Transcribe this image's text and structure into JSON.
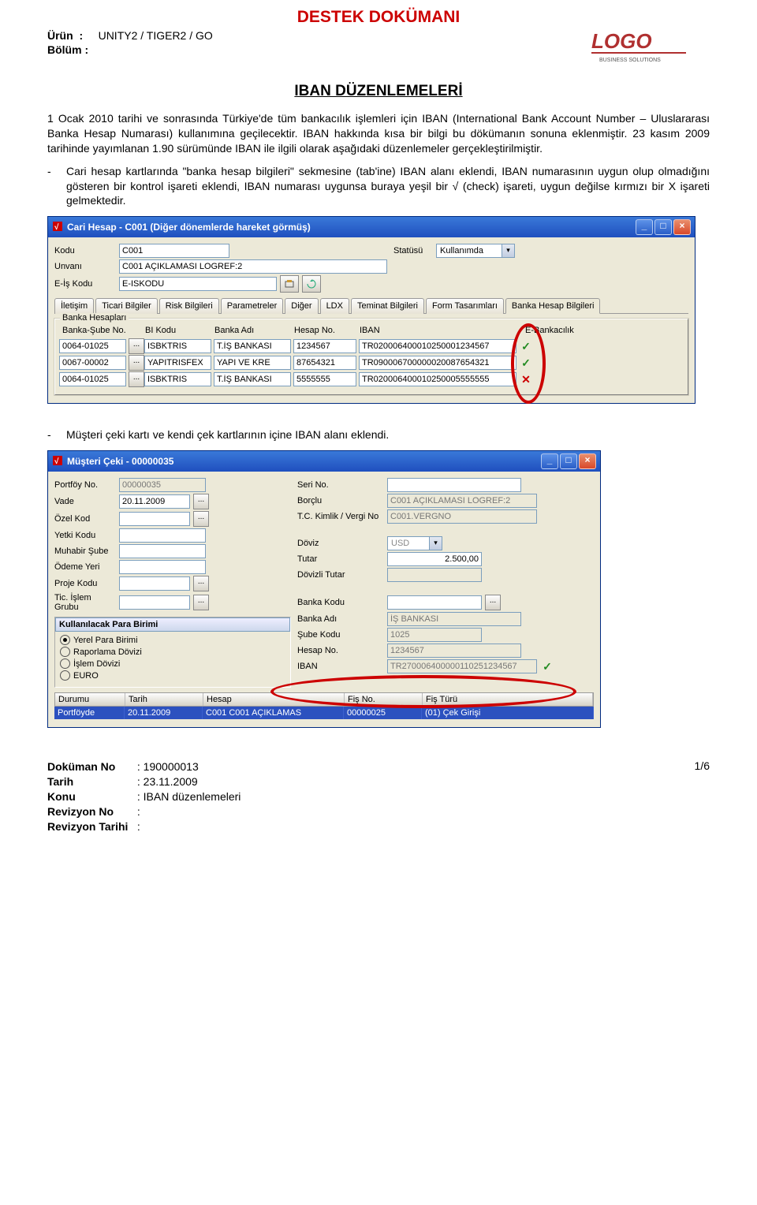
{
  "doc": {
    "title": "DESTEK DOKÜMANI",
    "urun_label": "Ürün",
    "urun_value": "UNITY2 / TIGER2 / GO",
    "bolum_label": "Bölüm",
    "logo_text": "LOGO",
    "logo_sub": "BUSINESS SOLUTIONS",
    "section_title": "IBAN DÜZENLEMELERİ",
    "para1": "1 Ocak 2010 tarihi ve sonrasında Türkiye'de tüm bankacılık işlemleri için IBAN (International Bank Account Number – Uluslararası Banka Hesap Numarası) kullanımına geçilecektir. IBAN hakkında kısa bir bilgi bu dökümanın sonuna eklenmiştir. 23 kasım 2009 tarihinde yayımlanan 1.90 sürümünde IBAN ile ilgili olarak aşağıdaki düzenlemeler gerçekleştirilmiştir.",
    "bullet1": "Cari hesap kartlarında \"banka hesap bilgileri\" sekmesine (tab'ine) IBAN alanı eklendi, IBAN numarasının uygun olup olmadığını gösteren bir kontrol işareti eklendi, IBAN numarası uygunsa buraya yeşil bir √ (check) işareti, uygun değilse kırmızı bir X işareti gelmektedir.",
    "bullet2": "Müşteri çeki kartı ve kendi çek kartlarının içine IBAN alanı eklendi.",
    "page_no": "1/6",
    "footer": {
      "dokuman_no_label": "Doküman No",
      "dokuman_no": "190000013",
      "tarih_label": "Tarih",
      "tarih": "23.11.2009",
      "konu_label": "Konu",
      "konu": "IBAN düzenlemeleri",
      "revno_label": "Revizyon No",
      "revno": "",
      "revtarih_label": "Revizyon Tarihi",
      "revtarih": ""
    }
  },
  "dlg1": {
    "title": "Cari Hesap - C001 (Diğer dönemlerde hareket görmüş)",
    "labels": {
      "kodu": "Kodu",
      "unvani": "Unvanı",
      "eis": "E-İş Kodu",
      "statusu": "Statüsü"
    },
    "kodu": "C001",
    "unvani": "C001 AÇIKLAMASI LOGREF:2",
    "eis": "E-ISKODU",
    "statusu": "Kullanımda",
    "tabs": [
      "İletişim",
      "Ticari Bilgiler",
      "Risk Bilgileri",
      "Parametreler",
      "Diğer",
      "LDX",
      "Teminat Bilgileri",
      "Form Tasarımları",
      "Banka Hesap Bilgileri"
    ],
    "banka_frame_title": "Banka Hesapları",
    "banka_headers": {
      "sube": "Banka-Şube No.",
      "bikodu": "BI Kodu",
      "bankadi": "Banka Adı",
      "hesap": "Hesap No.",
      "iban": "IBAN",
      "ebank": "E-Bankacılık"
    },
    "banka_rows": [
      {
        "sube": "0064-01025",
        "bi": "ISBKTRIS",
        "ad": "T.İŞ BANKASI",
        "hesap": "1234567",
        "iban": "TR020006400010250001234567",
        "ok": true
      },
      {
        "sube": "0067-00002",
        "bi": "YAPITRISFEX",
        "ad": "YAPI VE KRE",
        "hesap": "87654321",
        "iban": "TR090006700000020087654321",
        "ok": true
      },
      {
        "sube": "0064-01025",
        "bi": "ISBKTRIS",
        "ad": "T.İŞ BANKASI",
        "hesap": "5555555",
        "iban": "TR020006400010250005555555",
        "ok": false
      }
    ]
  },
  "dlg2": {
    "title": "Müşteri Çeki - 00000035",
    "left": {
      "portfoy_label": "Portföy No.",
      "portfoy": "00000035",
      "vade_label": "Vade",
      "vade": "20.11.2009",
      "ozelkod_label": "Özel Kod",
      "ozelkod": "",
      "yetki_label": "Yetki Kodu",
      "yetki": "",
      "muhabir_label": "Muhabir Şube",
      "muhabir": "",
      "odeme_label": "Ödeme Yeri",
      "odeme": "",
      "proje_label": "Proje Kodu",
      "proje": "",
      "ticislem_label": "Tic. İşlem Grubu",
      "ticislem": ""
    },
    "right": {
      "seri_label": "Seri No.",
      "seri": "",
      "borclu_label": "Borçlu",
      "borclu": "C001 AÇIKLAMASI LOGREF:2",
      "tckimlik_label": "T.C. Kimlik / Vergi No",
      "tckimlik": "C001.VERGNO",
      "doviz_label": "Döviz",
      "doviz": "USD",
      "tutar_label": "Tutar",
      "tutar": "2.500,00",
      "dovizli_label": "Dövizli Tutar",
      "dovizli": "",
      "bankakodu_label": "Banka Kodu",
      "bankakodu": "",
      "bankadi_label": "Banka Adı",
      "bankadi": "İŞ BANKASI",
      "subekodu_label": "Şube Kodu",
      "subekodu": "1025",
      "hesapno_label": "Hesap No.",
      "hesapno": "1234567",
      "iban_label": "IBAN",
      "iban": "TR270006400000110251234567"
    },
    "para": {
      "title": "Kullanılacak Para Birimi",
      "options": [
        "Yerel Para Birimi",
        "Raporlama Dövizi",
        "İşlem Dövizi",
        "EURO"
      ],
      "selected": 0
    },
    "grid": {
      "headers": {
        "durum": "Durumu",
        "tarih": "Tarih",
        "hesap": "Hesap",
        "fisno": "Fiş No.",
        "fisturu": "Fiş Türü"
      },
      "row": {
        "durum": "Portföyde",
        "tarih": "20.11.2009",
        "hesap": "C001 C001 AÇIKLAMAS",
        "fisno": "00000025",
        "fisturu": "(01) Çek Girişi"
      }
    }
  }
}
